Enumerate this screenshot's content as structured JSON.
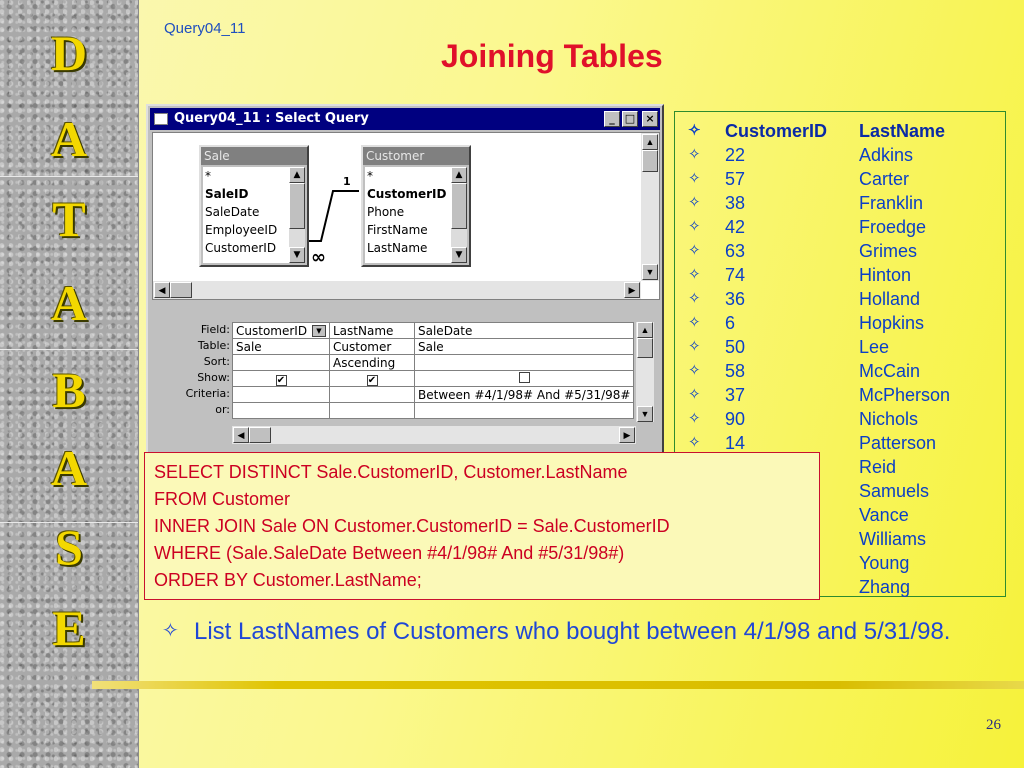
{
  "slide": {
    "query_ref": "Query04_11",
    "title": "Joining Tables",
    "sidebar_letters": [
      "D",
      "A",
      "T",
      "A",
      "B",
      "A",
      "S",
      "E"
    ],
    "page_number": "26",
    "colors": {
      "title": "#e0102a",
      "text_blue": "#1f47d6",
      "sql_red": "#cc0022",
      "sidebar_letter": "#f3d800"
    }
  },
  "access_window": {
    "title": "Query04_11 : Select Query",
    "buttons": {
      "minimize": "_",
      "maximize": "□",
      "close": "×"
    },
    "tables": [
      {
        "name": "Sale",
        "fields": [
          "*",
          "SaleID",
          "SaleDate",
          "EmployeeID",
          "CustomerID"
        ],
        "key_field": "SaleID"
      },
      {
        "name": "Customer",
        "fields": [
          "*",
          "CustomerID",
          "Phone",
          "FirstName",
          "LastName"
        ],
        "key_field": "CustomerID"
      }
    ],
    "relationship": {
      "one_side": "1",
      "many_side": "∞"
    },
    "grid_row_labels": [
      "Field:",
      "Table:",
      "Sort:",
      "Show:",
      "Criteria:",
      "or:"
    ],
    "grid_columns": [
      {
        "field": "CustomerID",
        "table": "Sale",
        "sort": "",
        "show": true,
        "criteria": "",
        "or": ""
      },
      {
        "field": "LastName",
        "table": "Customer",
        "sort": "Ascending",
        "show": true,
        "criteria": "",
        "or": ""
      },
      {
        "field": "SaleDate",
        "table": "Sale",
        "sort": "",
        "show": false,
        "criteria": "Between #4/1/98# And #5/31/98#",
        "or": ""
      }
    ]
  },
  "results": {
    "headers": [
      "CustomerID",
      "LastName"
    ],
    "rows": [
      [
        "22",
        "Adkins"
      ],
      [
        "57",
        "Carter"
      ],
      [
        "38",
        "Franklin"
      ],
      [
        "42",
        "Froedge"
      ],
      [
        "63",
        "Grimes"
      ],
      [
        "74",
        "Hinton"
      ],
      [
        "36",
        "Holland"
      ],
      [
        "6",
        "Hopkins"
      ],
      [
        "50",
        "Lee"
      ],
      [
        "58",
        "McCain"
      ],
      [
        "37",
        "McPherson"
      ],
      [
        "90",
        "Nichols"
      ],
      [
        "14",
        "Patterson"
      ],
      [
        "",
        "Reid"
      ],
      [
        "",
        "Samuels"
      ],
      [
        "",
        "Vance"
      ],
      [
        "",
        "Williams"
      ],
      [
        "",
        "Young"
      ],
      [
        "",
        "Zhang"
      ]
    ],
    "bullet": "✧"
  },
  "sql": {
    "lines": [
      "SELECT DISTINCT Sale.CustomerID, Customer.LastName",
      "FROM Customer",
      "INNER JOIN Sale ON Customer.CustomerID = Sale.CustomerID",
      "WHERE (Sale.SaleDate Between #4/1/98# And #5/31/98#)",
      "ORDER BY Customer.LastName;"
    ]
  },
  "bullet_point": {
    "marker": "✧",
    "text": "List LastNames of Customers who bought between 4/1/98 and 5/31/98."
  }
}
